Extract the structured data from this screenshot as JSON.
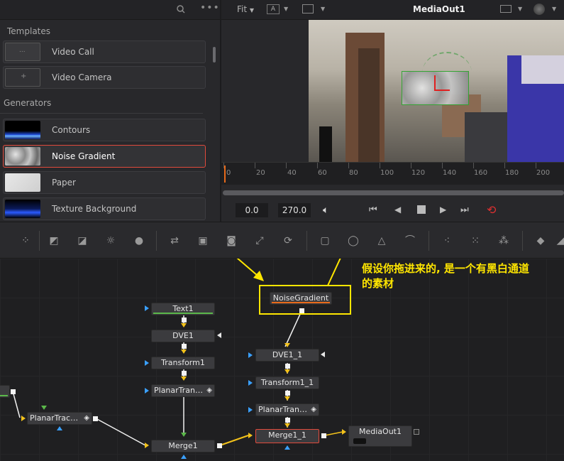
{
  "left_panel": {
    "search_icon": "search-icon",
    "more_icon": "more-icon",
    "templates_title": "Templates",
    "generators_title": "Generators",
    "templates": [
      {
        "label": "Video Call"
      },
      {
        "label": "Video Camera"
      }
    ],
    "generators": [
      {
        "label": "Contours"
      },
      {
        "label": "Noise Gradient",
        "selected": true
      },
      {
        "label": "Paper"
      },
      {
        "label": "Texture Background"
      }
    ]
  },
  "viewer": {
    "fit_label": "Fit",
    "channel_label": "A",
    "title": "MediaOut1"
  },
  "timeline": {
    "ticks": [
      "0",
      "20",
      "40",
      "60",
      "80",
      "100",
      "120",
      "140",
      "160",
      "180",
      "200"
    ],
    "start_value": "0.0",
    "end_value": "270.0"
  },
  "nodes": {
    "text1": "Text1",
    "dve1": "DVE1",
    "transform1": "Transform1",
    "planartran_a": "PlanarTran…",
    "planartrac": "PlanarTrac…",
    "merge1": "Merge1",
    "noisegradient": "NoiseGradient",
    "dve1_1": "DVE1_1",
    "transform1_1": "Transform1_1",
    "planartran_b": "PlanarTran…",
    "merge1_1": "Merge1_1",
    "mediaout1": "MediaOut1"
  },
  "annotation": {
    "line1": "假设你拖进来的, 是一个有黑白通道",
    "line2": "的素材"
  },
  "colors": {
    "accent_red": "#e04a3c",
    "annotation_yellow": "#ffe600",
    "port_blue": "#3aa0ff",
    "port_yellow": "#f3c21b"
  }
}
